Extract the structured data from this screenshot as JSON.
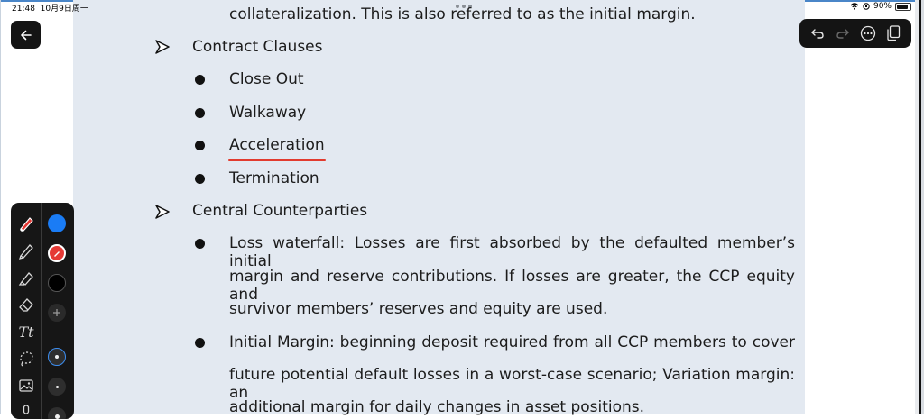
{
  "status_bar": {
    "time": "21:48",
    "date": "10月9日周一",
    "battery": "90%"
  },
  "document": {
    "lines": [
      {
        "id": "collateral",
        "text": "collateralization. This is also referred to as the initial margin."
      },
      {
        "id": "contract_clauses",
        "text": "Contract Clauses"
      },
      {
        "id": "close_out",
        "text": "Close Out"
      },
      {
        "id": "walkaway",
        "text": "Walkaway"
      },
      {
        "id": "acceleration",
        "text": "Acceleration"
      },
      {
        "id": "termination",
        "text": "Termination"
      },
      {
        "id": "central_counterparties",
        "text": "Central Counterparties"
      },
      {
        "id": "loss_1",
        "text": "Loss waterfall: Losses are first absorbed by the defaulted member’s initial"
      },
      {
        "id": "loss_2",
        "text": "margin and reserve contributions. If losses are greater, the CCP equity and"
      },
      {
        "id": "loss_3",
        "text": "survivor members’ reserves and equity are used."
      },
      {
        "id": "im_1",
        "text": "Initial Margin: beginning deposit required from all CCP members to cover"
      },
      {
        "id": "im_2",
        "text": "future potential default losses in a worst-case scenario; Variation margin: an"
      },
      {
        "id": "im_3",
        "text": "additional margin for daily changes in asset positions."
      }
    ]
  },
  "toolbar": {
    "back_icon": "arrow-left-icon",
    "top_actions": [
      "undo-icon",
      "redo-icon",
      "more-icon",
      "pages-icon"
    ]
  },
  "palette": {
    "tools": [
      "highlighter-pen-icon",
      "pencil-icon",
      "marker-icon",
      "eraser-icon",
      "text-tool-icon",
      "lasso-icon",
      "image-icon"
    ],
    "text_tool_label": "Tt",
    "colors": [
      "#1a7cf5",
      "#e53935",
      "#000000"
    ],
    "add_color_icon": "plus-icon"
  },
  "annotation": {
    "underline_color": "#e23b2e"
  }
}
